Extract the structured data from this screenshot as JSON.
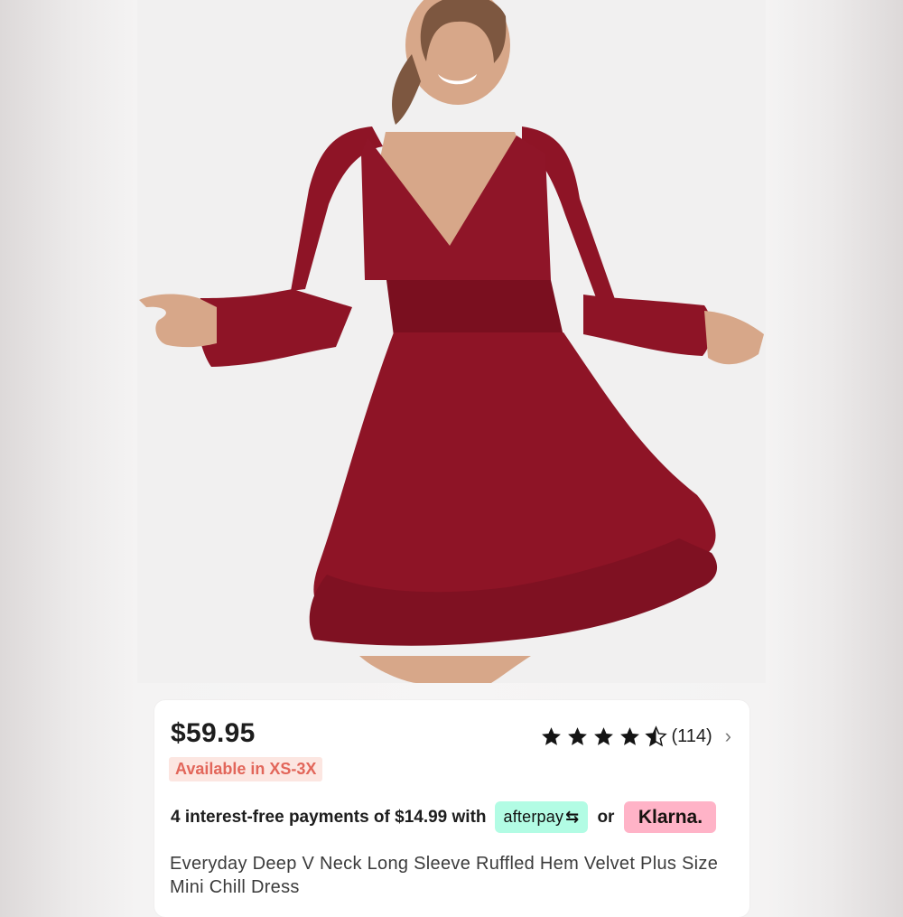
{
  "product": {
    "price": "$59.95",
    "availability": "Available in XS-3X",
    "rating": {
      "stars": 4.5,
      "reviews": "(114)"
    },
    "payments": {
      "text": "4 interest-free payments of $14.99 with",
      "afterpay_label": "afterpay",
      "afterpay_symbol": "⇆",
      "or": "or",
      "klarna_label": "Klarna."
    },
    "title": "Everyday Deep V Neck Long Sleeve Ruffled Hem Velvet Plus Size Mini Chill Dress"
  },
  "icons": {
    "chevron": "›"
  },
  "colors": {
    "dress": "#8e1426",
    "availability_text": "#e2665a",
    "availability_bg": "#fce6e1",
    "afterpay_bg": "#b2fce4",
    "klarna_bg": "#ffb3c7"
  }
}
